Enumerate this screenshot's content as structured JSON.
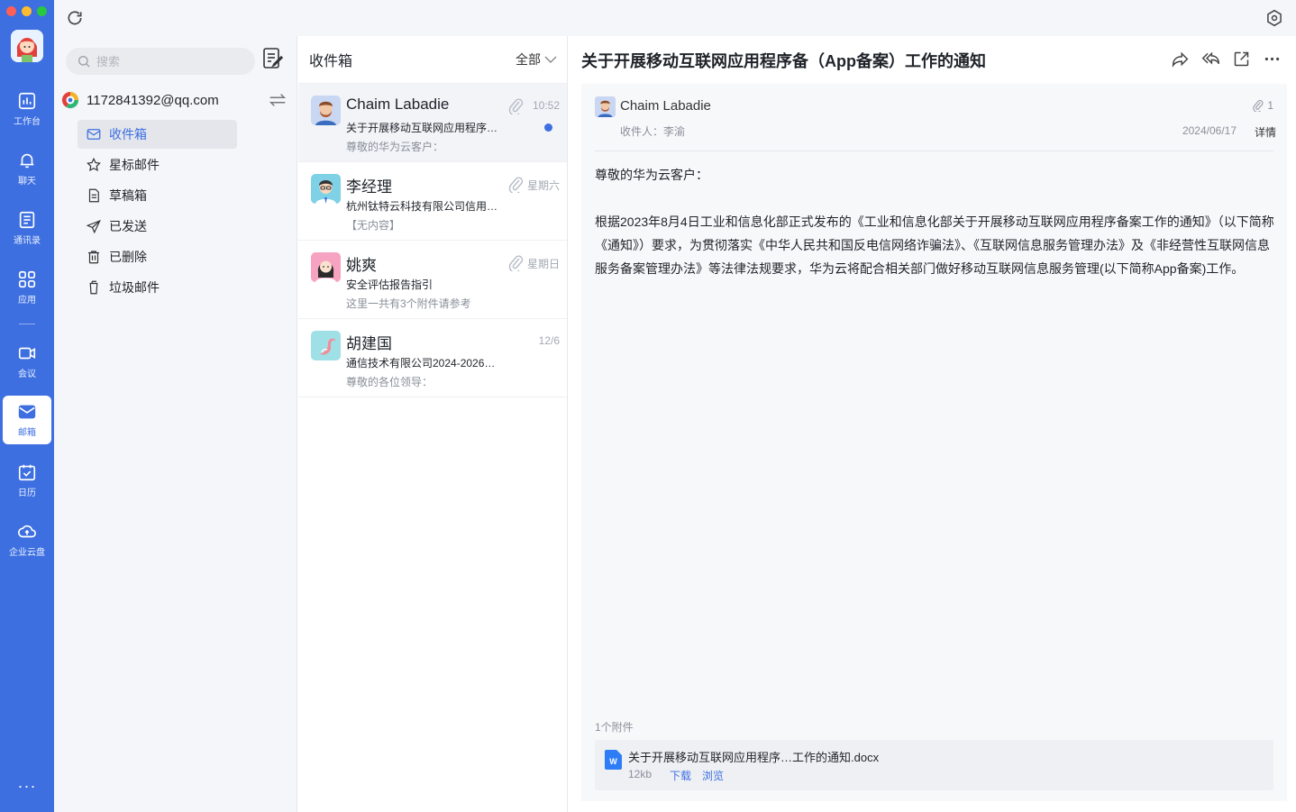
{
  "colors": {
    "accent": "#3d6fe0",
    "rail_bg": "#3d6fe0",
    "unread_dot": "#3d6fe0"
  },
  "rail": {
    "items": [
      {
        "label": "工作台",
        "icon": "dashboard-icon"
      },
      {
        "label": "聊天",
        "icon": "bell-icon"
      },
      {
        "label": "通讯录",
        "icon": "contacts-icon"
      },
      {
        "label": "应用",
        "icon": "apps-grid-icon"
      },
      {
        "label": "会议",
        "icon": "video-camera-icon"
      },
      {
        "label": "邮箱",
        "icon": "mail-icon"
      },
      {
        "label": "日历",
        "icon": "calendar-icon"
      },
      {
        "label": "企业云盘",
        "icon": "cloud-icon"
      }
    ],
    "active": "邮箱",
    "more_label": "···"
  },
  "search": {
    "placeholder": "搜索"
  },
  "account": {
    "email": "1172841392@qq.com"
  },
  "folders": [
    {
      "label": "收件箱",
      "icon": "inbox-mail-icon",
      "active": true
    },
    {
      "label": "星标邮件",
      "icon": "star-icon"
    },
    {
      "label": "草稿箱",
      "icon": "draft-icon"
    },
    {
      "label": "已发送",
      "icon": "send-icon"
    },
    {
      "label": "已删除",
      "icon": "trash-icon"
    },
    {
      "label": "垃圾邮件",
      "icon": "junk-icon"
    }
  ],
  "list": {
    "title": "收件箱",
    "filter": "全部",
    "messages": [
      {
        "sender": "Chaim Labadie",
        "subject": "关于开展移动互联网应用程序…",
        "preview": "尊敬的华为云客户：",
        "time": "10:52",
        "has_attachment": true,
        "unread": true
      },
      {
        "sender": "李经理",
        "subject": "杭州钛特云科技有限公司信用…",
        "preview": "【无内容】",
        "time": "星期六",
        "has_attachment": true,
        "unread": false
      },
      {
        "sender": "姚爽",
        "subject": "安全评估报告指引",
        "preview": "这里一共有3个附件请参考",
        "time": "星期日",
        "has_attachment": true,
        "unread": false
      },
      {
        "sender": "胡建国",
        "subject": "通信技术有限公司2024-2026年…",
        "preview": "尊敬的各位领导：",
        "time": "12/6",
        "has_attachment": false,
        "unread": false
      }
    ]
  },
  "reader": {
    "title": "关于开展移动互联网应用程序备（App备案）工作的通知",
    "from": "Chaim Labadie",
    "attachment_count_badge": "1",
    "recipient": "收件人：李渝",
    "date": "2024/06/17",
    "detail_label": "详情",
    "greeting": "尊敬的华为云客户：",
    "paragraph": "根据2023年8月4日工业和信息化部正式发布的《工业和信息化部关于开展移动互联网应用程序备案工作的通知》（以下简称《通知》）要求，为贯彻落实《中华人民共和国反电信网络诈骗法》、《互联网信息服务管理办法》及《非经营性互联网信息服务备案管理办法》等法律法规要求，华为云将配合相关部门做好移动互联网信息服务管理(以下简称App备案)工作。",
    "attachments_label": "1个附件",
    "attachment": {
      "name": "关于开展移动互联网应用程序…工作的通知.docx",
      "size": "12kb",
      "download": "下载",
      "preview": "浏览"
    }
  }
}
